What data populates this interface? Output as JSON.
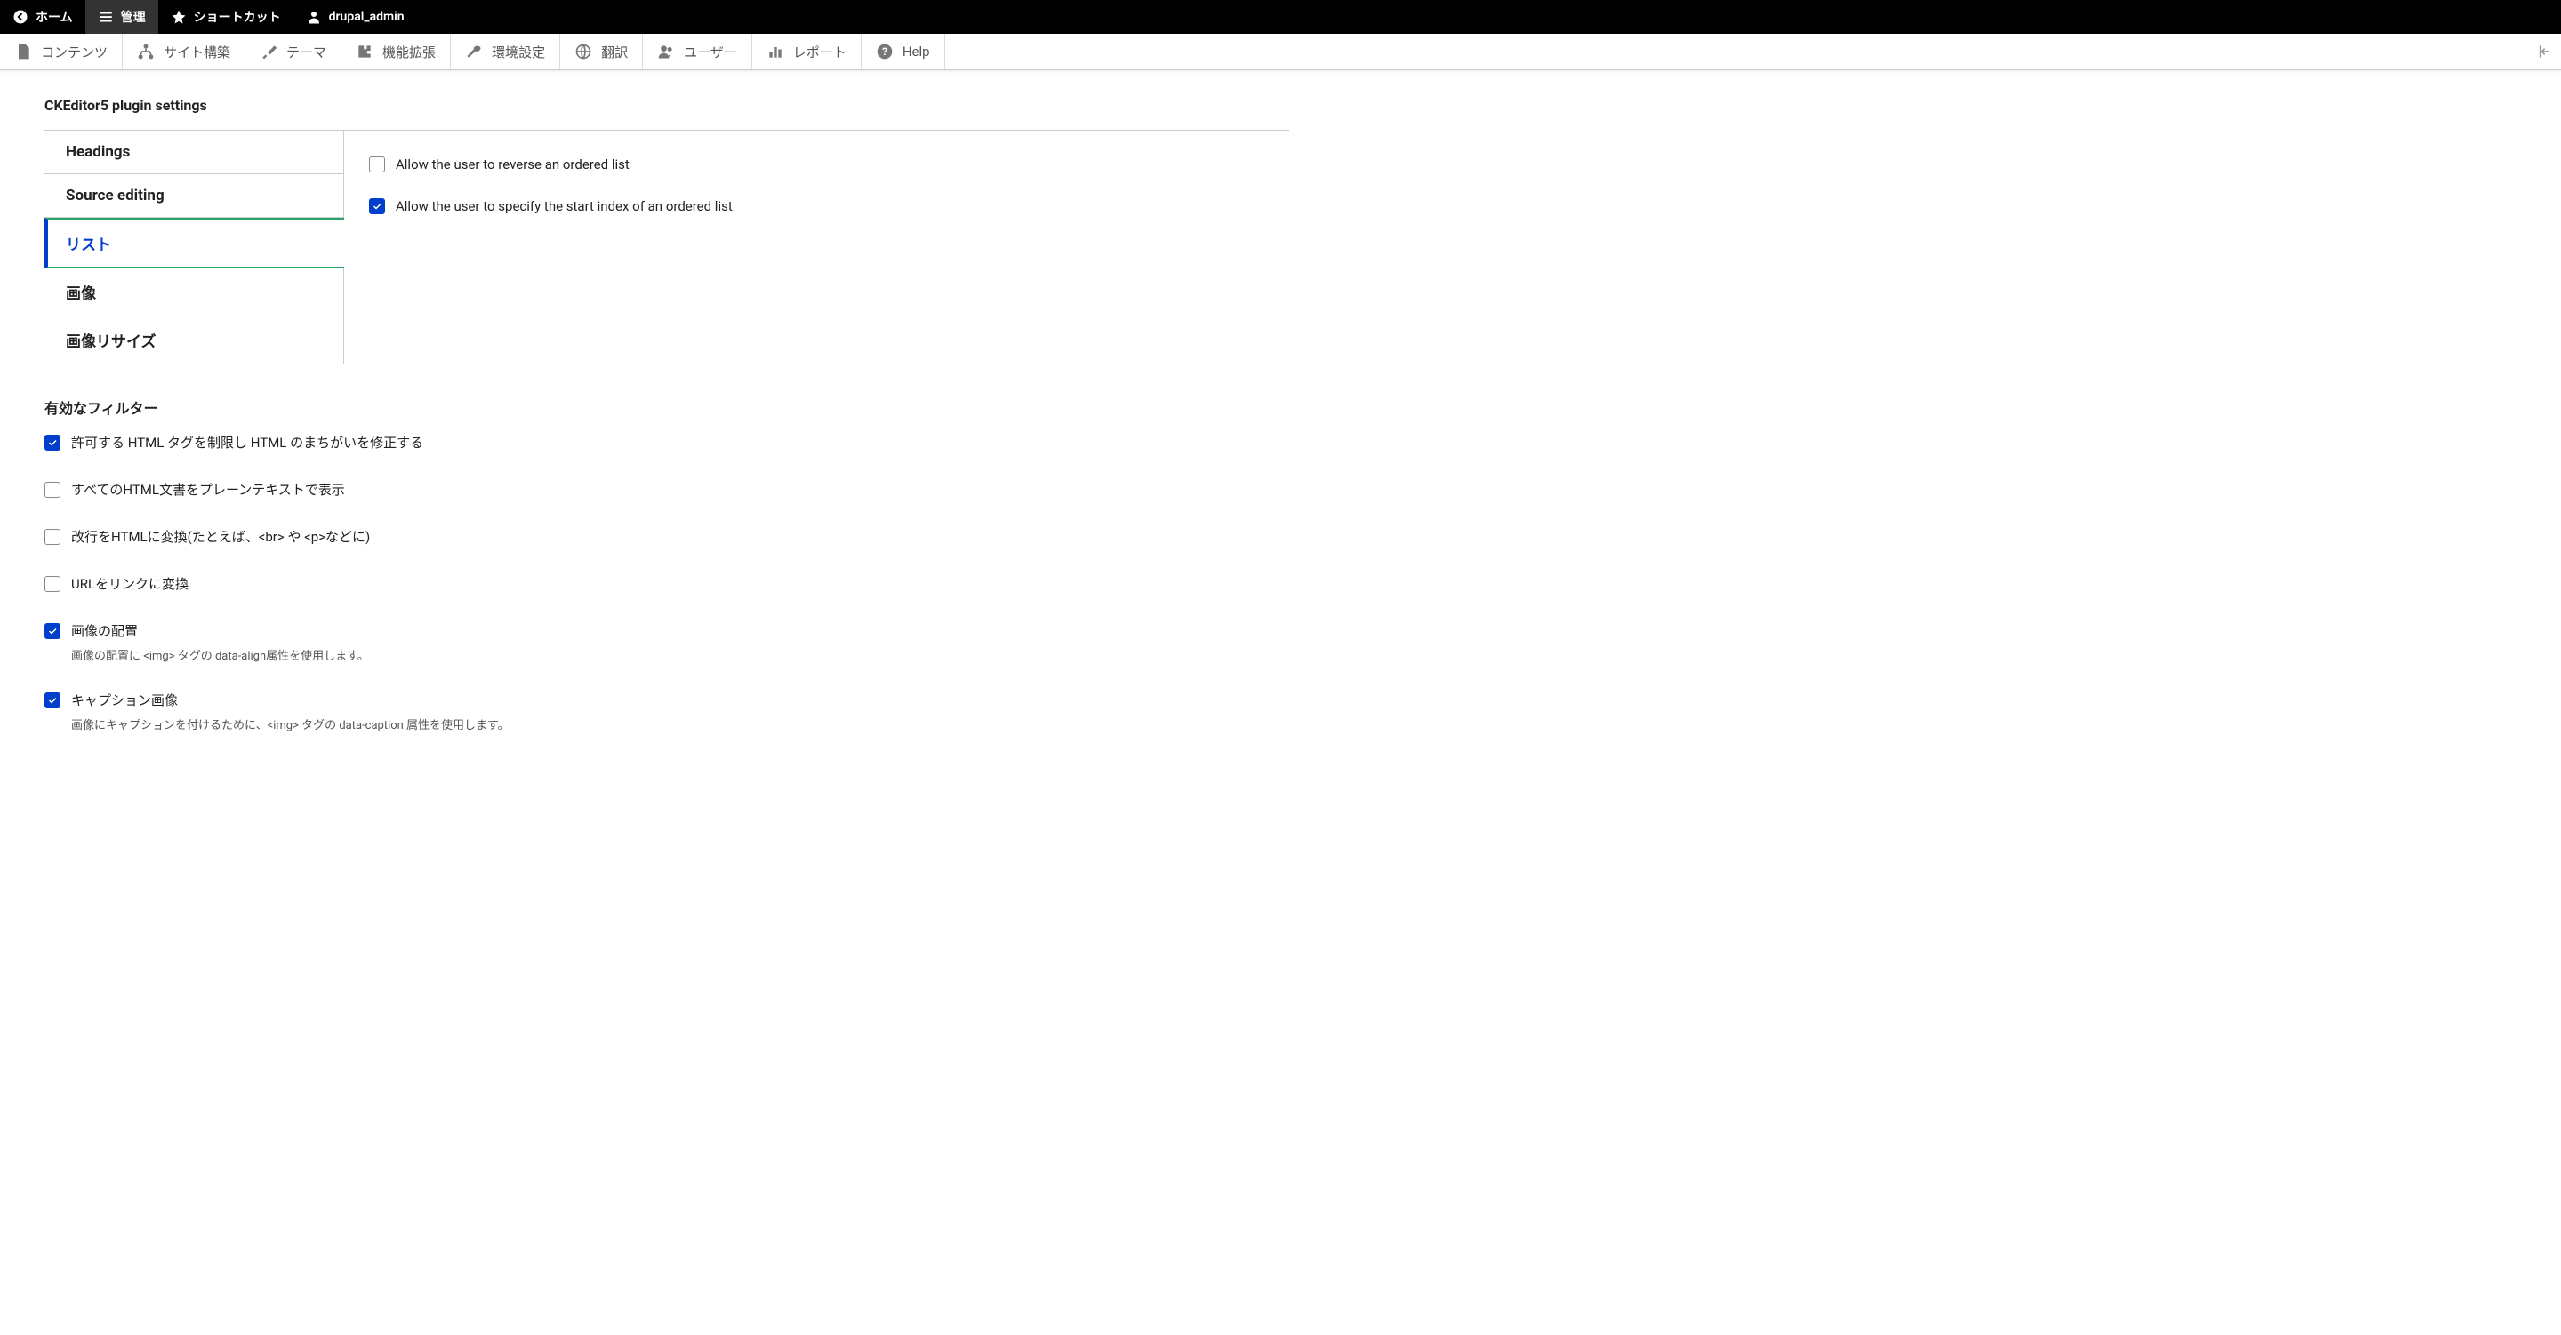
{
  "top_toolbar": {
    "home": "ホーム",
    "manage": "管理",
    "shortcuts": "ショートカット",
    "user": "drupal_admin"
  },
  "admin_toolbar": {
    "content": "コンテンツ",
    "structure": "サイト構築",
    "appearance": "テーマ",
    "extend": "機能拡張",
    "config": "環境設定",
    "translate": "翻訳",
    "people": "ユーザー",
    "reports": "レポート",
    "help": "Help"
  },
  "plugin": {
    "heading": "CKEditor5 plugin settings",
    "tabs": {
      "headings": "Headings",
      "source_editing": "Source editing",
      "list": "リスト",
      "image": "画像",
      "image_resize": "画像リサイズ"
    },
    "list_pane": {
      "reverse": "Allow the user to reverse an ordered list",
      "start_index": "Allow the user to specify the start index of an ordered list"
    }
  },
  "filters": {
    "heading": "有効なフィルター",
    "items": {
      "limit_html": {
        "label": "許可する HTML タグを制限し HTML のまちがいを修正する",
        "checked": true
      },
      "plaintext": {
        "label": "すべてのHTML文書をプレーンテキストで表示",
        "checked": false
      },
      "linebreak": {
        "label": "改行をHTMLに変換(たとえば、<br> や <p>などに)",
        "checked": false
      },
      "url_link": {
        "label": "URLをリンクに変換",
        "checked": false
      },
      "image_align": {
        "label": "画像の配置",
        "checked": true,
        "desc": "画像の配置に <img> タグの data-align属性を使用します。"
      },
      "image_caption": {
        "label": "キャプション画像",
        "checked": true,
        "desc": "画像にキャプションを付けるために、<img> タグの data-caption 属性を使用します。"
      }
    }
  }
}
